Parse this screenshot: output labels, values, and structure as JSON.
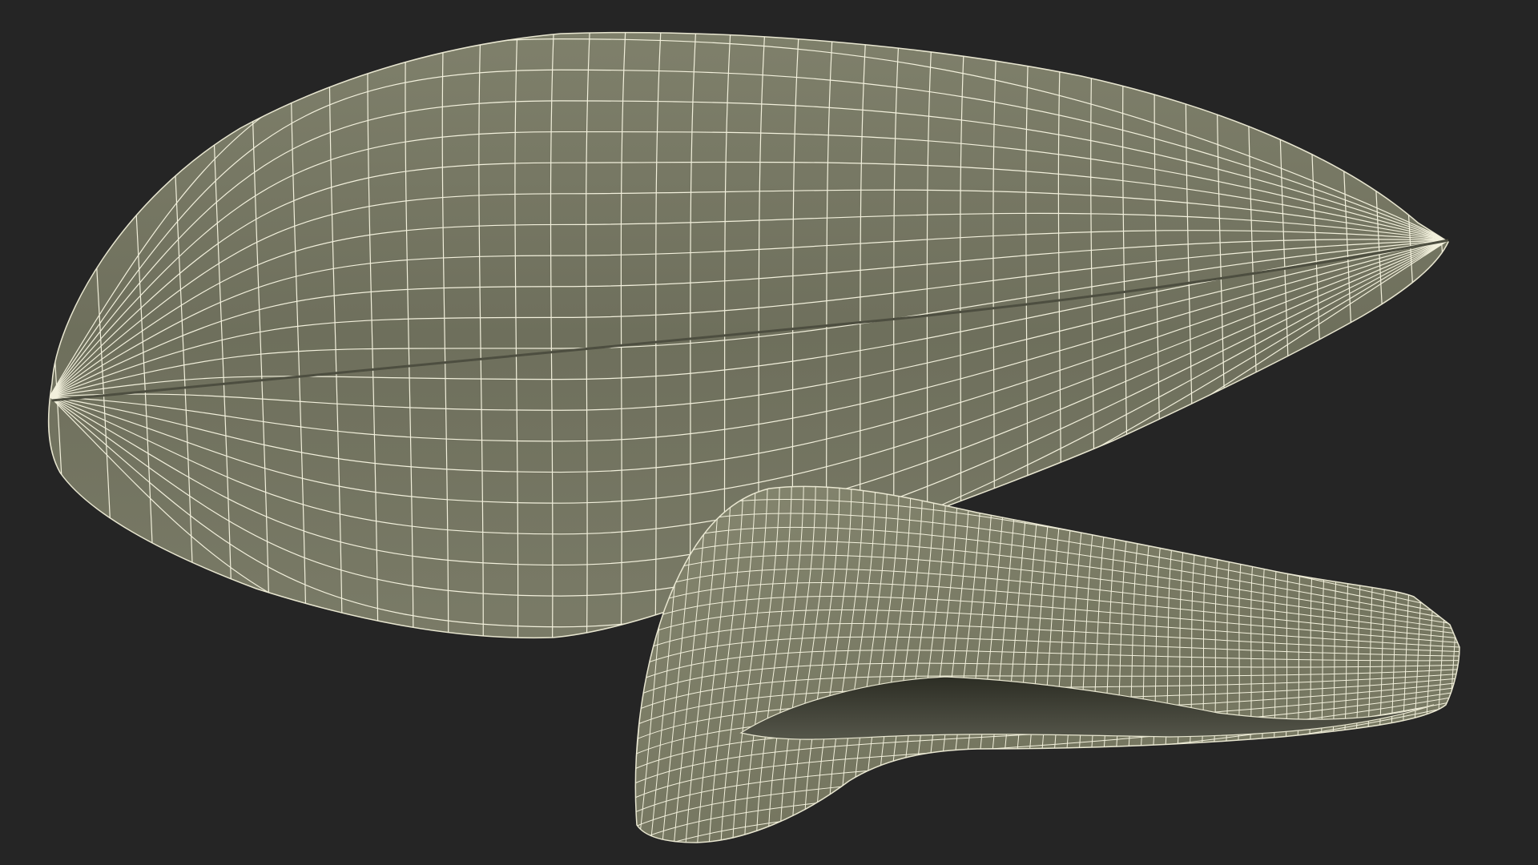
{
  "viewport": {
    "background_color": "#252525",
    "subject": "wireframe-mussel-shells",
    "render_mode": "wireframe-on-shaded"
  },
  "colors": {
    "shell_fill": "#7b7c68",
    "shell_fill_dark": "#5f604f",
    "shell_fill_light": "#8a8b76",
    "wire_color": "#f2f0dc",
    "inner_shadow": "#3a3b30"
  },
  "objects": [
    {
      "name": "large-closed-shell",
      "state": "closed"
    },
    {
      "name": "small-open-shell",
      "state": "open"
    }
  ]
}
